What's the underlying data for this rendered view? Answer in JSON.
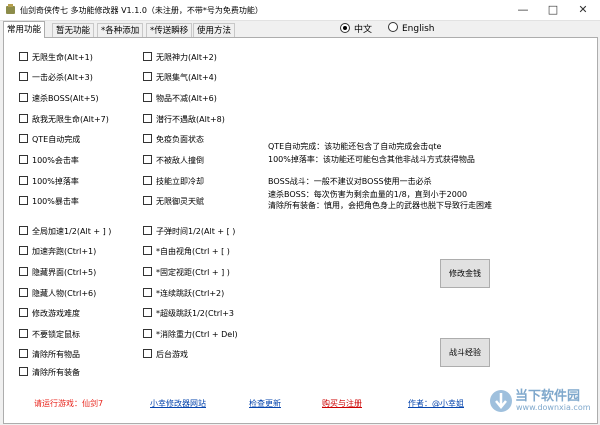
{
  "window": {
    "title": "仙剑奇侠传七 多功能修改器 V1.1.0（未注册，不带*号为免费功能）"
  },
  "tabs": [
    "常用功能",
    "暂无功能",
    "*各种添加",
    "*传送瞬移",
    "使用方法"
  ],
  "language": {
    "options": [
      "中文",
      "English"
    ],
    "selected": "中文"
  },
  "left_col_a": [
    "无限生命(Alt+1)",
    "一击必杀(Alt+3)",
    "速杀BOSS(Alt+5)",
    "敌我无限生命(Alt+7)",
    "QTE自动完成",
    "100%会击率",
    "100%掉落率",
    "100%暴击率"
  ],
  "right_col_a": [
    "无限神力(Alt+2)",
    "无限集气(Alt+4)",
    "物品不减(Alt+6)",
    "潜行不遇敌(Alt+8)",
    "免疫负面状态",
    "不被敌人撞倒",
    "技能立即冷却",
    "无限御灵天赋"
  ],
  "left_col_b": [
    "全局加速1/2(Alt + ] )",
    "加速奔跑(Ctrl+1)",
    "隐藏界面(Ctrl+5)",
    "隐藏人物(Ctrl+6)",
    "修改游戏难度",
    "不要锁定鼠标",
    "清除所有物品",
    "清除所有装备"
  ],
  "right_col_b": [
    "子弹时间1/2(Alt + [ )",
    "*自由视角(Ctrl + [ )",
    "*固定视距(Ctrl + ] )",
    "*连续跳跃(Ctrl+2)",
    "*超级跳跃1/2(Ctrl+3",
    "*消除重力(Ctrl + Del)",
    "后台游戏"
  ],
  "info_lines": [
    "QTE自动完成：该功能还包含了自动完成会击qte",
    "100%掉落率：该功能还可能包含其他非战斗方式获得物品",
    "BOSS战斗：一般不建议对BOSS使用一击必杀",
    "速杀BOSS：每次伤害为剩余血量的1/8，直到小于2000",
    "清除所有装备：慎用，会把角色身上的武器也脱下导致行走困难"
  ],
  "buttons": {
    "modify_money": "修改金钱",
    "battle_exp": "战斗经验"
  },
  "footer": {
    "run_game": "请运行游戏：仙剑7",
    "site": "小幸修改器网站",
    "check_update": "检查更新",
    "buy_register": "购买与注册",
    "author": "作者：@小幸姐"
  },
  "watermark": {
    "name": "当下软件园",
    "url": "www.downxia.com"
  },
  "colors": {
    "footer_red": "#e8241c",
    "link_blue": "#0645ad",
    "accent": "#cc0000"
  }
}
